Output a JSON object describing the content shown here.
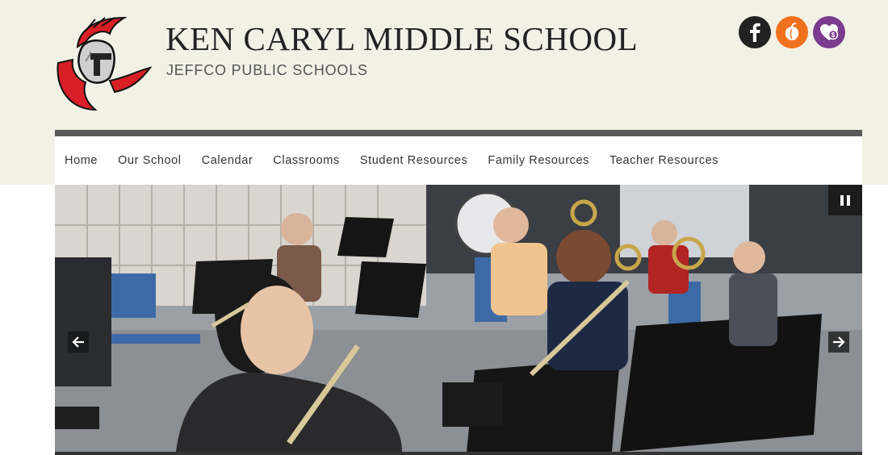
{
  "header": {
    "title": "KEN CARYL MIDDLE SCHOOL",
    "subtitle": "JEFFCO PUBLIC SCHOOLS",
    "logo_icon": "spartan-helmet-icon"
  },
  "social": [
    {
      "name": "facebook",
      "icon": "facebook-icon",
      "color": "#222222"
    },
    {
      "name": "peachjar",
      "icon": "peachjar-icon",
      "color": "#f0701e"
    },
    {
      "name": "donate",
      "icon": "donate-heart-icon",
      "color": "#7b3b8e"
    }
  ],
  "nav": {
    "items": [
      "Home",
      "Our School",
      "Calendar",
      "Classrooms",
      "Student Resources",
      "Family Resources",
      "Teacher Resources"
    ]
  },
  "slideshow": {
    "pause_icon": "pause-icon",
    "prev_icon": "arrow-left-icon",
    "next_icon": "arrow-right-icon"
  },
  "colors": {
    "header_bg": "#f2f1e6",
    "nav_divider": "#5a5a5a",
    "brand_red": "#d81f26"
  }
}
